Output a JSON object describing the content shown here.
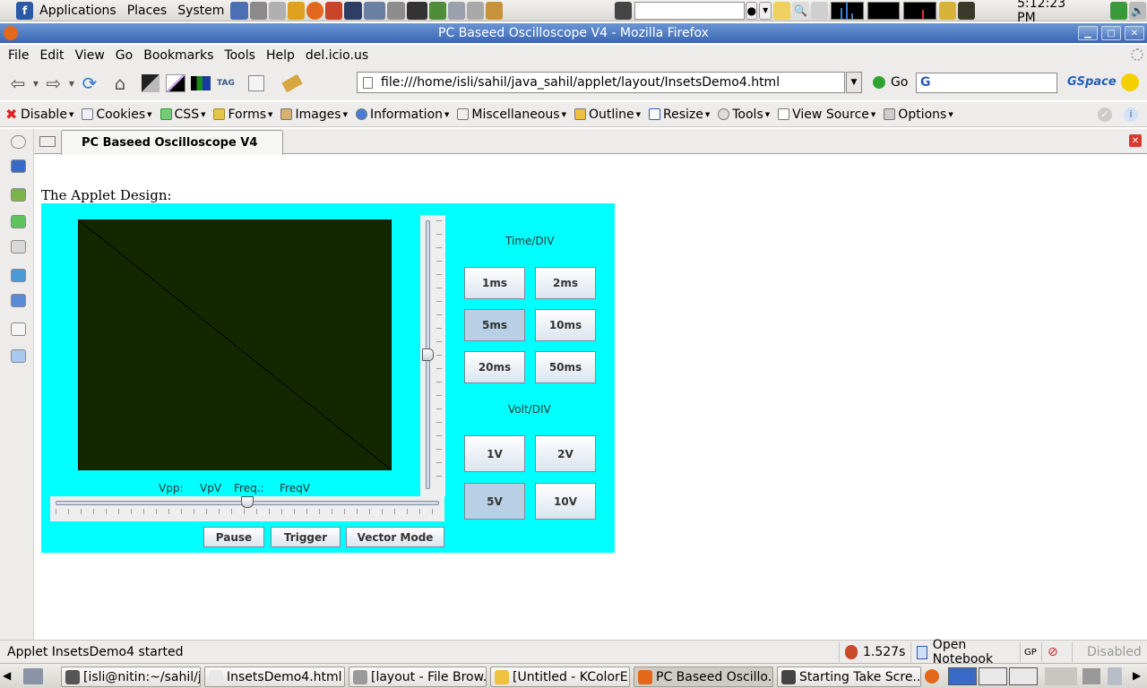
{
  "top_panel": {
    "menus": [
      "Applications",
      "Places",
      "System"
    ],
    "clock": "5:12:23 PM"
  },
  "window": {
    "title": "PC Baseed Oscilloscope V4 - Mozilla Firefox"
  },
  "menubar": {
    "items": [
      "File",
      "Edit",
      "View",
      "Go",
      "Bookmarks",
      "Tools",
      "Help",
      "del.icio.us"
    ]
  },
  "navbar": {
    "url": "file:///home/isli/sahil/java_sahil/applet/layout/InsetsDemo4.html",
    "go_label": "Go",
    "gspace_label": "GSpace",
    "tag_label": "TAG"
  },
  "devbar": {
    "items": [
      "Disable",
      "Cookies",
      "CSS",
      "Forms",
      "Images",
      "Information",
      "Miscellaneous",
      "Outline",
      "Resize",
      "Tools",
      "View Source",
      "Options"
    ]
  },
  "tab": {
    "title": "PC Baseed Oscilloscope V4"
  },
  "page": {
    "heading": "The Applet Design:",
    "applet": {
      "readouts": [
        "Vpp:",
        "VpV",
        "Freq.:",
        "FreqV"
      ],
      "time_div_label": "Time/DIV",
      "time_buttons": [
        {
          "label": "1ms",
          "selected": false
        },
        {
          "label": "2ms",
          "selected": false
        },
        {
          "label": "5ms",
          "selected": true
        },
        {
          "label": "10ms",
          "selected": false
        },
        {
          "label": "20ms",
          "selected": false
        },
        {
          "label": "50ms",
          "selected": false
        }
      ],
      "volt_div_label": "Volt/DIV",
      "volt_buttons": [
        {
          "label": "1V",
          "selected": false
        },
        {
          "label": "2V",
          "selected": false
        },
        {
          "label": "5V",
          "selected": true
        },
        {
          "label": "10V",
          "selected": false
        }
      ],
      "bottom_buttons": [
        "Pause",
        "Trigger",
        "Vector Mode"
      ],
      "vertical_slider_value": 0.5,
      "horizontal_slider_value": 0.5,
      "screen_color": "#142800",
      "background_color": "#00ffff"
    }
  },
  "statusbar": {
    "text": "Applet InsetsDemo4 started",
    "timer": "1.527s",
    "notebook": "Open Notebook",
    "gp": "GP",
    "disabled": "Disabled"
  },
  "taskbar": {
    "tasks": [
      {
        "label": "[isli@nitin:~/sahil/j...",
        "active": false
      },
      {
        "label": "InsetsDemo4.html ...",
        "active": false
      },
      {
        "label": "[layout - File Brow...",
        "active": false
      },
      {
        "label": "[Untitled - KColorE...",
        "active": false
      },
      {
        "label": "PC Baseed Oscillo...",
        "active": true
      },
      {
        "label": "Starting Take Scre...",
        "active": false
      }
    ]
  }
}
